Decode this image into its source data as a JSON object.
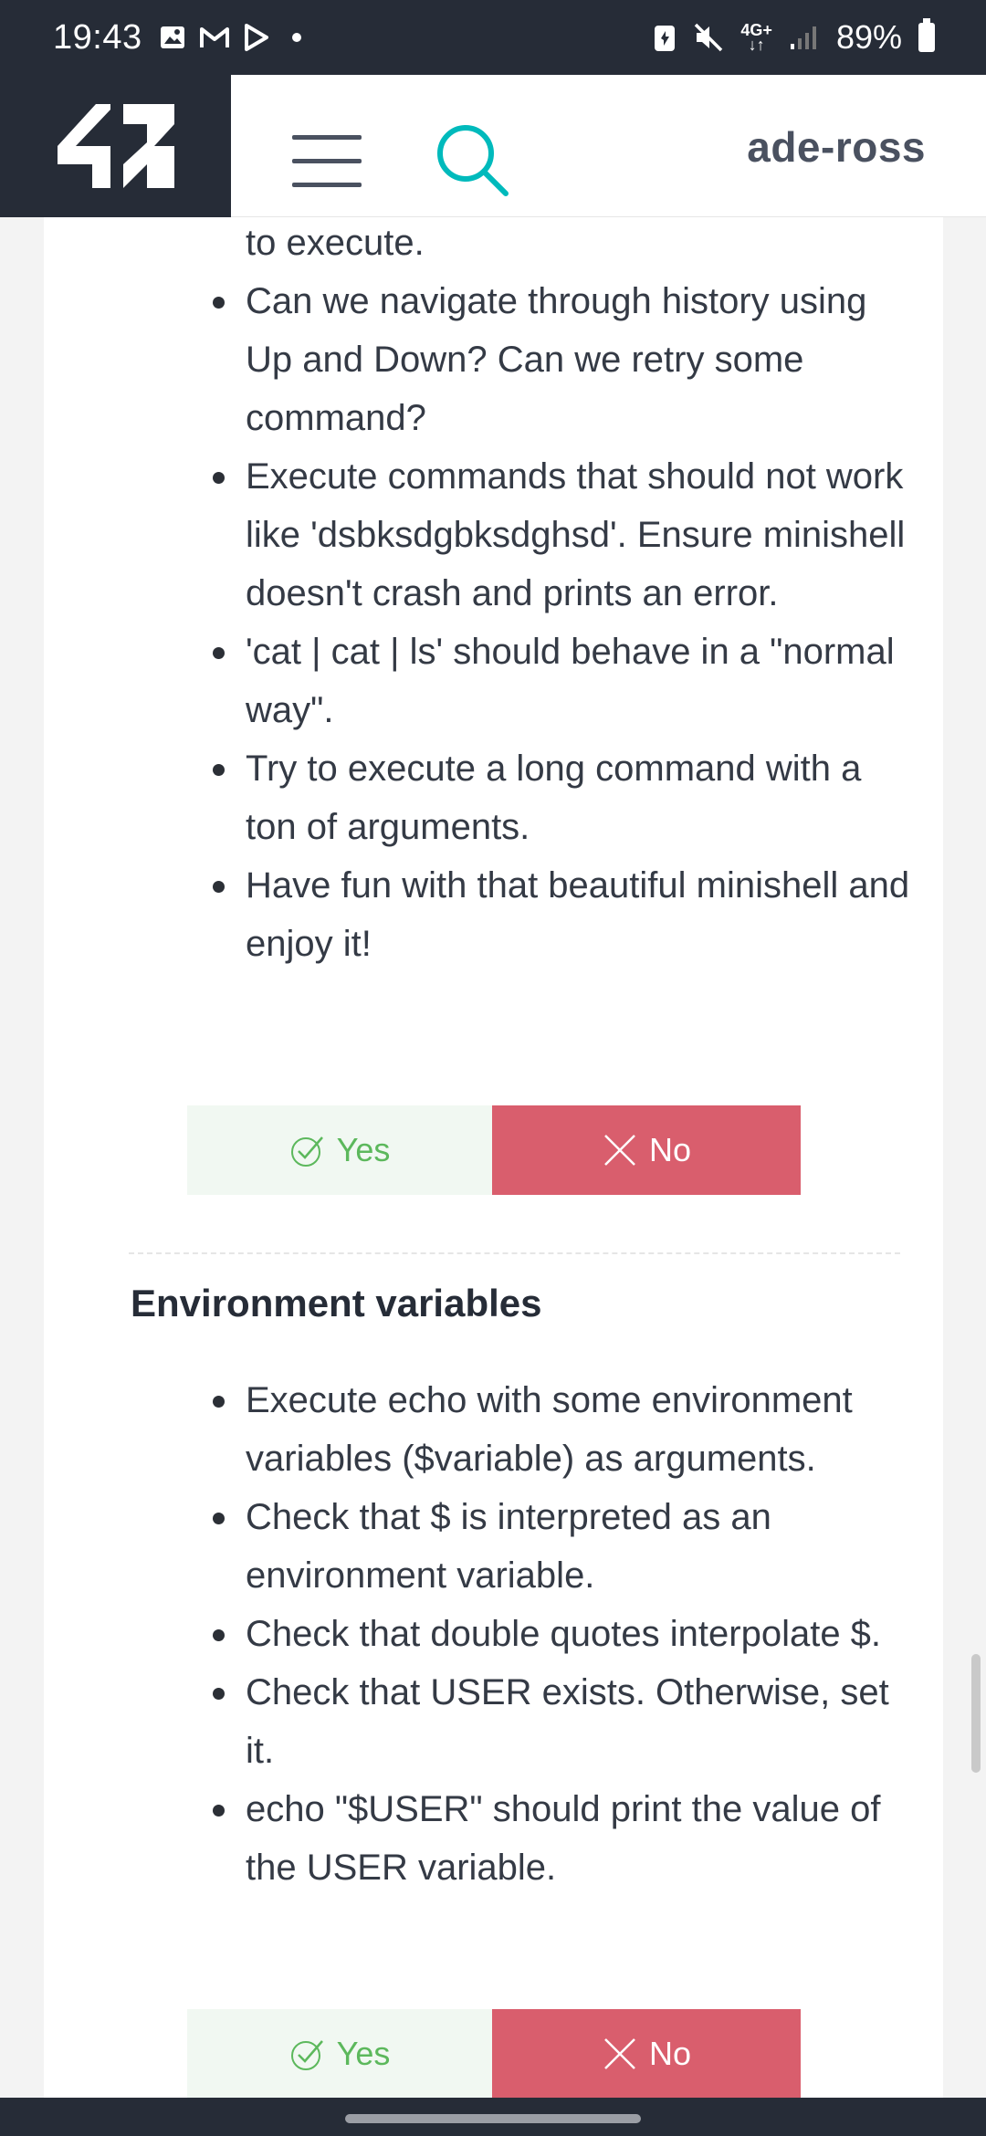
{
  "status_bar": {
    "time": "19:43",
    "network_top": "4G+",
    "battery": "89%"
  },
  "header": {
    "logo_text": "42",
    "username": "ade-ross"
  },
  "section1": {
    "continued_text": "to execute.",
    "items": [
      "Can we navigate through history using Up and Down? Can we retry some command?",
      "Execute commands that should not work like 'dsbksdgbksdghsd'. Ensure minishell doesn't crash and prints an error.",
      "'cat | cat | ls' should behave in a \"normal way\".",
      "Try to execute a long command with a ton of arguments.",
      "Have fun with that beautiful minishell and enjoy it!"
    ],
    "yes_label": "Yes",
    "no_label": "No"
  },
  "section2": {
    "title": "Environment variables",
    "items": [
      "Execute echo with some environment variables ($variable) as arguments.",
      "Check that $ is interpreted as an environment variable.",
      "Check that double quotes interpolate $.",
      "Check that USER exists. Otherwise, set it.",
      "echo \"$USER\" should print the value of the USER variable."
    ],
    "yes_label": "Yes",
    "no_label": "No"
  },
  "colors": {
    "dark": "#262c37",
    "accent": "#00babc",
    "yes_bg": "#f1f8f2",
    "yes_text": "#5cb85c",
    "no_bg": "#d95e6d"
  },
  "icons": {
    "menu": "hamburger-icon",
    "search": "search-icon",
    "check": "check-icon",
    "cross": "close-icon"
  }
}
